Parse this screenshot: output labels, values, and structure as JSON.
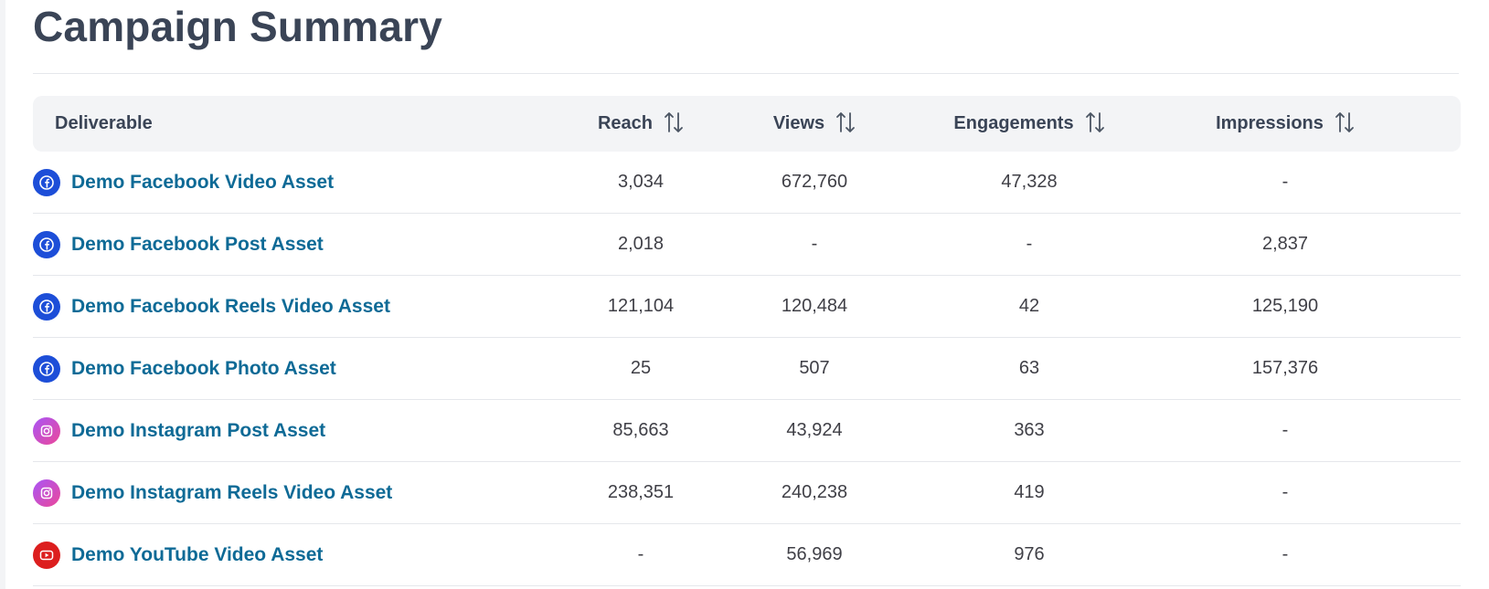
{
  "title": "Campaign Summary",
  "table": {
    "headers": {
      "deliverable": "Deliverable",
      "reach": "Reach",
      "views": "Views",
      "engagements": "Engagements",
      "impressions": "Impressions"
    },
    "rows": [
      {
        "platform": "facebook",
        "icon": "facebook-icon",
        "name": "Demo Facebook Video Asset",
        "reach": "3,034",
        "views": "672,760",
        "engagements": "47,328",
        "impressions": "-"
      },
      {
        "platform": "facebook",
        "icon": "facebook-icon",
        "name": "Demo Facebook Post Asset",
        "reach": "2,018",
        "views": "-",
        "engagements": "-",
        "impressions": "2,837"
      },
      {
        "platform": "facebook",
        "icon": "facebook-icon",
        "name": "Demo Facebook Reels Video Asset",
        "reach": "121,104",
        "views": "120,484",
        "engagements": "42",
        "impressions": "125,190"
      },
      {
        "platform": "facebook",
        "icon": "facebook-icon",
        "name": "Demo Facebook Photo Asset",
        "reach": "25",
        "views": "507",
        "engagements": "63",
        "impressions": "157,376"
      },
      {
        "platform": "instagram",
        "icon": "instagram-icon",
        "name": "Demo Instagram Post Asset",
        "reach": "85,663",
        "views": "43,924",
        "engagements": "363",
        "impressions": "-"
      },
      {
        "platform": "instagram",
        "icon": "instagram-icon",
        "name": "Demo Instagram Reels Video Asset",
        "reach": "238,351",
        "views": "240,238",
        "engagements": "419",
        "impressions": "-"
      },
      {
        "platform": "youtube",
        "icon": "youtube-icon",
        "name": "Demo YouTube Video Asset",
        "reach": "-",
        "views": "56,969",
        "engagements": "976",
        "impressions": "-"
      }
    ]
  },
  "colors": {
    "link": "#0e6a96",
    "facebook": "#1d4ed8",
    "youtube": "#dc1e1e",
    "header_bg": "#f3f4f6"
  }
}
